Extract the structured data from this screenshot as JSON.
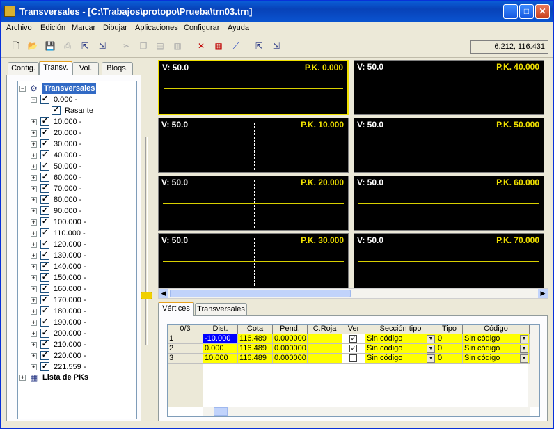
{
  "window": {
    "title": "Transversales - [C:\\Trabajos\\protopo\\Prueba\\trn03.trn]",
    "controls": {
      "minimize": "_",
      "maximize": "□",
      "close": "✕"
    }
  },
  "menu": [
    "Archivo",
    "Edición",
    "Marcar",
    "Dibujar",
    "Aplicaciones",
    "Configurar",
    "Ayuda"
  ],
  "toolbar": {
    "icons": [
      "new-file-icon",
      "open-folder-icon",
      "save-icon",
      "print-icon",
      "export-icon",
      "import-icon",
      "cut-icon",
      "copy-icon",
      "paste-icon",
      "paste-special-icon",
      "cross-section-icon",
      "table-edit-icon",
      "line-draw-icon",
      "layer-export-icon",
      "layer-import-icon"
    ],
    "coordinates": "6.212, 116.431"
  },
  "left_tabs": [
    "Config.",
    "Transv.",
    "Vol.",
    "Bloqs."
  ],
  "active_left_tab": "Transv.",
  "tree": {
    "root": "Transversales",
    "first": "0.000 -",
    "rasante": "Rasante",
    "items": [
      "10.000 -",
      "20.000 -",
      "30.000 -",
      "40.000 -",
      "50.000 -",
      "60.000 -",
      "70.000 -",
      "80.000 -",
      "90.000 -",
      "100.000 -",
      "110.000 -",
      "120.000 -",
      "130.000 -",
      "140.000 -",
      "150.000 -",
      "160.000 -",
      "170.000 -",
      "180.000 -",
      "190.000 -",
      "200.000 -",
      "210.000 -",
      "220.000 -",
      "221.559 -"
    ],
    "pk_list": "Lista de PKs"
  },
  "sections": [
    {
      "v": "V: 50.0",
      "pk": "P.K. 0.000"
    },
    {
      "v": "V: 50.0",
      "pk": "P.K. 40.000"
    },
    {
      "v": "V: 50.0",
      "pk": "P.K. 10.000"
    },
    {
      "v": "V: 50.0",
      "pk": "P.K. 50.000"
    },
    {
      "v": "V: 50.0",
      "pk": "P.K. 20.000"
    },
    {
      "v": "V: 50.0",
      "pk": "P.K. 60.000"
    },
    {
      "v": "V: 50.0",
      "pk": "P.K. 30.000"
    },
    {
      "v": "V: 50.0",
      "pk": "P.K. 70.000"
    }
  ],
  "bottom_tabs": [
    "Vértices",
    "Transversales"
  ],
  "table": {
    "counter": "0/3",
    "headers": [
      "Dist.",
      "Cota",
      "Pend.",
      "C.Roja",
      "Ver",
      "Sección tipo",
      "Tipo",
      "Código"
    ],
    "rows": [
      {
        "n": "1",
        "dist": "-10.000",
        "cota": "116.489",
        "pend": "0.000000",
        "croja": "",
        "ver": true,
        "seccion": "Sin código",
        "tipo": "0",
        "codigo": "Sin código"
      },
      {
        "n": "2",
        "dist": "0.000",
        "cota": "116.489",
        "pend": "0.000000",
        "croja": "",
        "ver": true,
        "seccion": "Sin código",
        "tipo": "0",
        "codigo": "Sin código"
      },
      {
        "n": "3",
        "dist": "10.000",
        "cota": "116.489",
        "pend": "0.000000",
        "croja": "",
        "ver": false,
        "seccion": "Sin código",
        "tipo": "0",
        "codigo": "Sin código"
      }
    ]
  },
  "colors": {
    "section_bg": "#000000",
    "pk_text": "#f0e000",
    "cell_yellow": "#ffff00",
    "selected_cell": "#0000ff"
  }
}
